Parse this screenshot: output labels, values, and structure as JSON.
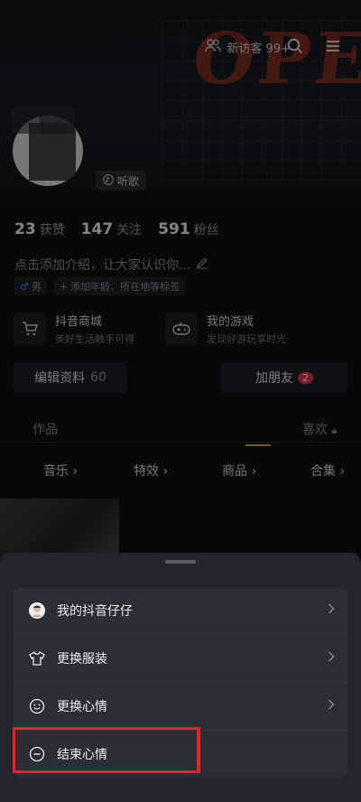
{
  "header": {
    "visitors_label": "新访客 99+",
    "neon_text": "OPEN",
    "listen_label": "听歌"
  },
  "stats": [
    {
      "value": "23",
      "label": "获赞"
    },
    {
      "value": "147",
      "label": "关注"
    },
    {
      "value": "591",
      "label": "粉丝"
    }
  ],
  "bio": {
    "placeholder": "点击添加介绍，让大家认识你...",
    "gender_tag": "男",
    "add_tag": "添加年龄、所在地等标签"
  },
  "features": [
    {
      "title": "抖音商城",
      "subtitle": "美好生活触手可得",
      "icon": "cart-icon"
    },
    {
      "title": "我的游戏",
      "subtitle": "发现好游玩享时光",
      "icon": "gamepad-icon"
    }
  ],
  "actions": {
    "edit_profile": "编辑资料",
    "edit_suffix": "60",
    "add_friend": "加朋友",
    "add_friend_count": "2"
  },
  "tabs": {
    "works": "作品",
    "likes": "喜欢"
  },
  "subtabs": [
    "音乐",
    "特效",
    "商品",
    "合集"
  ],
  "sheet": {
    "items": [
      {
        "label": "我的抖音仔仔",
        "icon": "avatar-icon",
        "arrow": true
      },
      {
        "label": "更换服装",
        "icon": "shirt-icon",
        "arrow": true
      },
      {
        "label": "更换心情",
        "icon": "smile-icon",
        "arrow": true
      },
      {
        "label": "结束心情",
        "icon": "minus-circle-icon",
        "arrow": false
      }
    ]
  },
  "colors": {
    "highlight": "#e0262b",
    "sheet_bg": "#23242c",
    "menu_bg": "#2c2d35"
  }
}
